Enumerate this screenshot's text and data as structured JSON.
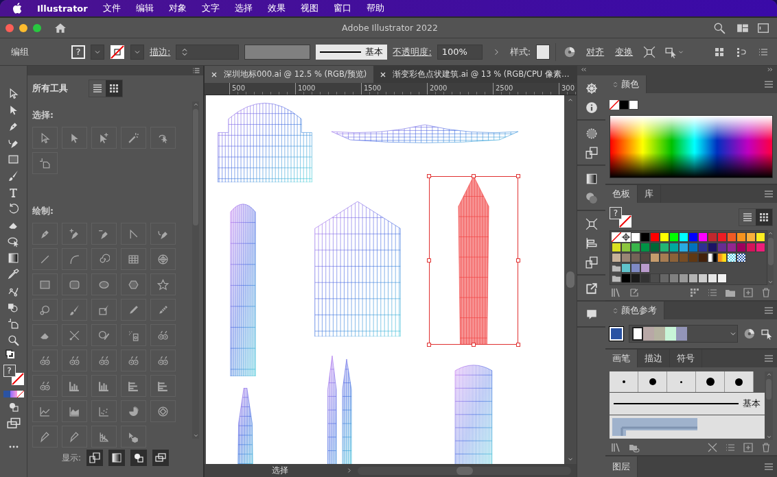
{
  "menu_bar": {
    "app": "Illustrator",
    "items": [
      "文件",
      "编辑",
      "对象",
      "文字",
      "选择",
      "效果",
      "视图",
      "窗口",
      "帮助"
    ]
  },
  "window": {
    "title": "Adobe Illustrator 2022"
  },
  "control_bar": {
    "selection": "编组",
    "fill_symbol": "?",
    "stroke_label": "描边:",
    "brush_style": "基本",
    "opacity_label": "不透明度:",
    "opacity": "100%",
    "style_label": "样式:",
    "align": "对齐",
    "transform": "变换"
  },
  "toolbar": {
    "fill_symbol": "?"
  },
  "tools_panel": {
    "title": "所有工具",
    "views": [
      {
        "kind": "list",
        "selected": false
      },
      {
        "kind": "grid",
        "selected": true
      }
    ],
    "sections": [
      {
        "label": "选择:"
      },
      {
        "label": "绘制:"
      }
    ],
    "display_label": "显示:"
  },
  "documents": [
    {
      "title": "深圳地标000.ai @ 12.5 % (RGB/预览)",
      "selected": true
    },
    {
      "title": "渐变彩色点状建筑.ai @ 13 % (RGB/CPU 像素…",
      "selected": false
    }
  ],
  "ruler": [
    "500",
    "1000",
    "1500",
    "2000",
    "2500",
    "300"
  ],
  "artboard": {
    "objects": [
      {
        "kind": "dome",
        "selected": false
      },
      {
        "kind": "stadium",
        "selected": false
      },
      {
        "kind": "round-tower",
        "selected": false
      },
      {
        "kind": "office",
        "selected": false
      },
      {
        "kind": "red-tower",
        "selected": true
      },
      {
        "kind": "spire",
        "selected": false
      },
      {
        "kind": "twin",
        "selected": false
      },
      {
        "kind": "tall-box",
        "selected": false
      }
    ]
  },
  "status_bar": {
    "tool": "选择"
  },
  "color_panel": {
    "title": "颜色"
  },
  "swatches_panel": {
    "tabs": [
      {
        "label": "色板",
        "selected": true
      },
      {
        "label": "库",
        "selected": false
      }
    ],
    "fill_symbol": "?",
    "views": [
      {
        "kind": "list",
        "selected": false
      },
      {
        "kind": "grid",
        "selected": true
      }
    ],
    "rows": [
      [
        {
          "kind": "none"
        },
        {
          "kind": "registration"
        },
        {
          "kind": "color",
          "color": "#ffffff"
        },
        {
          "kind": "color",
          "color": "#000000"
        },
        {
          "kind": "color",
          "color": "#ff0000"
        },
        {
          "kind": "color",
          "color": "#ffff00"
        },
        {
          "kind": "color",
          "color": "#00ff00"
        },
        {
          "kind": "color",
          "color": "#00ffff"
        },
        {
          "kind": "color",
          "color": "#0000ff"
        },
        {
          "kind": "color",
          "color": "#ff00ff"
        },
        {
          "kind": "color",
          "color": "#c1272d"
        },
        {
          "kind": "color",
          "color": "#ed1c24"
        },
        {
          "kind": "color",
          "color": "#f15a24"
        },
        {
          "kind": "color",
          "color": "#f7931e"
        },
        {
          "kind": "color",
          "color": "#fbb03b"
        },
        {
          "kind": "color",
          "color": "#fcee21"
        }
      ],
      [
        {
          "kind": "color",
          "color": "#d9e021"
        },
        {
          "kind": "color",
          "color": "#8cc63f"
        },
        {
          "kind": "color",
          "color": "#39b54a"
        },
        {
          "kind": "color",
          "color": "#009245"
        },
        {
          "kind": "color",
          "color": "#006837"
        },
        {
          "kind": "color",
          "color": "#22b573"
        },
        {
          "kind": "color",
          "color": "#00a99d"
        },
        {
          "kind": "color",
          "color": "#29abe2"
        },
        {
          "kind": "color",
          "color": "#0071bc"
        },
        {
          "kind": "color",
          "color": "#2e3192"
        },
        {
          "kind": "color",
          "color": "#1b1464"
        },
        {
          "kind": "color",
          "color": "#662d91"
        },
        {
          "kind": "color",
          "color": "#93278f"
        },
        {
          "kind": "color",
          "color": "#9e005d"
        },
        {
          "kind": "color",
          "color": "#d4145a"
        },
        {
          "kind": "color",
          "color": "#ed1e79"
        }
      ],
      [
        {
          "kind": "color",
          "color": "#c7b299"
        },
        {
          "kind": "color",
          "color": "#998675"
        },
        {
          "kind": "color",
          "color": "#736357"
        },
        {
          "kind": "color",
          "color": "#534741"
        },
        {
          "kind": "color",
          "color": "#c69c6d"
        },
        {
          "kind": "color",
          "color": "#a67c52"
        },
        {
          "kind": "color",
          "color": "#8c6239"
        },
        {
          "kind": "color",
          "color": "#754c24"
        },
        {
          "kind": "color",
          "color": "#603813"
        },
        {
          "kind": "color",
          "color": "#42210b"
        },
        {
          "kind": "gradient",
          "stops": [
            {
              "color": "#ffffff"
            },
            {
              "color": "#000000"
            }
          ]
        },
        {
          "kind": "gradient",
          "stops": [
            {
              "color": "#f7931e"
            },
            {
              "color": "#ffde17"
            }
          ]
        },
        {
          "kind": "pattern",
          "color": "#5ad1e6"
        },
        {
          "kind": "pattern",
          "color": "#2a5caa"
        }
      ],
      [
        {
          "kind": "folder"
        },
        {
          "kind": "color",
          "color": "#5fc3cb"
        },
        {
          "kind": "color",
          "color": "#7f8ac4"
        },
        {
          "kind": "color",
          "color": "#b99bcc"
        }
      ],
      [
        {
          "kind": "folder"
        },
        {
          "kind": "color",
          "color": "#000000"
        },
        {
          "kind": "color",
          "color": "#1a1a1a"
        },
        {
          "kind": "color",
          "color": "#333333"
        },
        {
          "kind": "color",
          "color": "#4d4d4d"
        },
        {
          "kind": "color",
          "color": "#666666"
        },
        {
          "kind": "color",
          "color": "#808080"
        },
        {
          "kind": "color",
          "color": "#999999"
        },
        {
          "kind": "color",
          "color": "#b3b3b3"
        },
        {
          "kind": "color",
          "color": "#cccccc"
        },
        {
          "kind": "color",
          "color": "#e6e6e6"
        },
        {
          "kind": "color",
          "color": "#f2f2f2"
        }
      ]
    ]
  },
  "color_guide": {
    "title": "颜色参考",
    "base": {
      "color": "#2b53a3"
    },
    "harmony": [
      {
        "color": "#ffffff"
      },
      {
        "color": "#b8a8a6"
      },
      {
        "color": "#b5b3a0"
      },
      {
        "color": "#c8f5d8"
      },
      {
        "color": "#9395b8"
      }
    ]
  },
  "brushes_panel": {
    "tabs": [
      {
        "label": "画笔",
        "selected": true
      },
      {
        "label": "描边",
        "selected": false
      },
      {
        "label": "符号",
        "selected": false
      }
    ],
    "basic_label": "基本"
  },
  "layers_panel": {
    "title": "图层"
  }
}
